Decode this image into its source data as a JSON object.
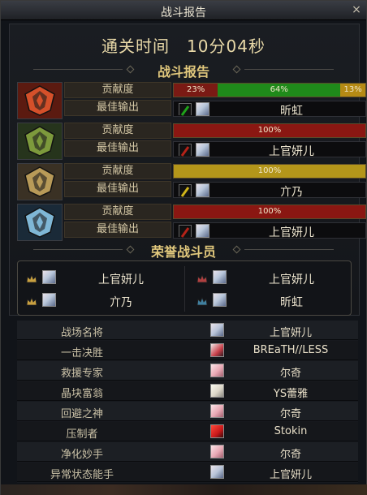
{
  "window": {
    "title": "战斗报告",
    "close_symbol": "×"
  },
  "clear_time": "通关时间　10分04秒",
  "section_report": "战斗报告",
  "section_honor": "荣誉战斗员",
  "labels": {
    "contribution": "贡献度",
    "best_output": "最佳输出"
  },
  "teams": [
    {
      "emblem": "fire-emblem-icon",
      "segments": [
        {
          "label": "23%",
          "value": 23,
          "color": "#7a1a14"
        },
        {
          "label": "64%",
          "value": 64,
          "color": "#1f8a1a"
        },
        {
          "label": "13%",
          "value": 13,
          "color": "#b58a14"
        }
      ],
      "best": {
        "weapon_color": "#1fa31a",
        "name": "昕虹"
      }
    },
    {
      "emblem": "forest-emblem-icon",
      "segments": [
        {
          "label": "100%",
          "value": 100,
          "color": "#8a1712"
        }
      ],
      "best": {
        "weapon_color": "#b52218",
        "name": "上官妍儿"
      }
    },
    {
      "emblem": "gold-emblem-icon",
      "segments": [
        {
          "label": "100%",
          "value": 100,
          "color": "#b4961a"
        }
      ],
      "best": {
        "weapon_color": "#d0b41a",
        "name": "亣乃"
      }
    },
    {
      "emblem": "ice-emblem-icon",
      "segments": [
        {
          "label": "100%",
          "value": 100,
          "color": "#8a1712"
        }
      ],
      "best": {
        "weapon_color": "#b52218",
        "name": "上官妍儿"
      }
    }
  ],
  "honor": [
    {
      "name": "上官妍儿"
    },
    {
      "name": "上官妍儿"
    },
    {
      "name": "亣乃"
    },
    {
      "name": "昕虹"
    }
  ],
  "awards": [
    {
      "title": "战场名将",
      "player": "上官妍儿",
      "portrait": "silver"
    },
    {
      "title": "一击决胜",
      "player": "BREaTH//LESS",
      "portrait": "red"
    },
    {
      "title": "救援专家",
      "player": "尔奇",
      "portrait": "pink"
    },
    {
      "title": "晶块富翁",
      "player": "YS蕾雅",
      "portrait": "pale"
    },
    {
      "title": "回避之神",
      "player": "尔奇",
      "portrait": "pink"
    },
    {
      "title": "压制者",
      "player": "Stokin",
      "portrait": "redface"
    },
    {
      "title": "净化妙手",
      "player": "尔奇",
      "portrait": "pink"
    },
    {
      "title": "异常状态能手",
      "player": "上官妍儿",
      "portrait": "silver"
    }
  ]
}
